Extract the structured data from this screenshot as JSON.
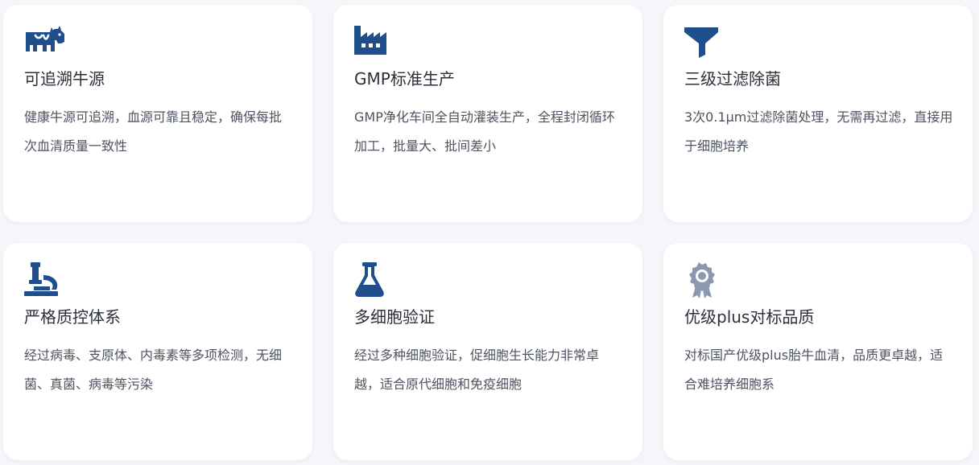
{
  "theme": {
    "icon_color": "#1f4e8c",
    "icon_color_muted": "#8a99ad",
    "page_background": "#f4f6fa",
    "card_background": "#ffffff"
  },
  "features": [
    {
      "icon": "cow-icon",
      "title": "可追溯牛源",
      "description": "健康牛源可追溯，血源可靠且稳定，确保每批次血清质量一致性"
    },
    {
      "icon": "factory-icon",
      "title": "GMP标准生产",
      "description": "GMP净化车间全自动灌装生产，全程封闭循环加工，批量大、批间差小"
    },
    {
      "icon": "filter-icon",
      "title": "三级过滤除菌",
      "description": "3次0.1μm过滤除菌处理，无需再过滤，直接用于细胞培养"
    },
    {
      "icon": "microscope-icon",
      "title": "严格质控体系",
      "description": "经过病毒、支原体、内毒素等多项检测，无细菌、真菌、病毒等污染"
    },
    {
      "icon": "flask-icon",
      "title": "多细胞验证",
      "description": "经过多种细胞验证，促细胞生长能力非常卓越，适合原代细胞和免疫细胞"
    },
    {
      "icon": "award-badge-icon",
      "title": "优级plus对标品质",
      "description": "对标国产优级plus胎牛血清，品质更卓越，适合难培养细胞系"
    }
  ]
}
